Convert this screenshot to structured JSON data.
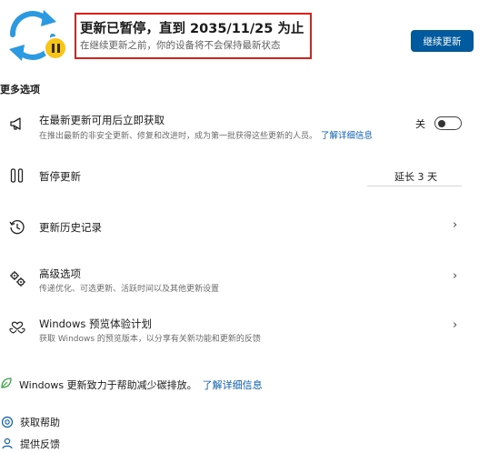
{
  "header": {
    "title": "更新已暂停，直到 2035/11/25 为止",
    "subtitle": "在继续更新之前，你的设备将不会保持最新状态",
    "resume_label": "继续更新"
  },
  "more_options": {
    "label": "更多选项",
    "items": [
      {
        "title": "在最新更新可用后立即获取",
        "desc": "在推出最新的非安全更新、修复和改进时，成为第一批获得这些更新的人员。",
        "link": "了解详细信息",
        "toggle_label": "关",
        "toggle_state": "off"
      },
      {
        "title": "暂停更新",
        "dropdown": "延长 3 天"
      },
      {
        "title": "更新历史记录"
      },
      {
        "title": "高级选项",
        "desc": "传递优化、可选更新、活跃时间以及其他更新设置"
      },
      {
        "title": "Windows 预览体验计划",
        "desc": "获取 Windows 的预览版本，以分享有关新功能和更新的反馈"
      }
    ]
  },
  "carbon": {
    "text": "Windows 更新致力于帮助减少碳排放。",
    "link": "了解详细信息"
  },
  "footer": {
    "get_help": "获取帮助",
    "feedback": "提供反馈"
  },
  "colors": {
    "accent": "#005a9e",
    "link": "#0a5fb4",
    "highlight_border": "#e0201b",
    "pause_badge": "#f5c518",
    "sync_icon": "#2b9ae0",
    "leaf_icon": "#3aa545"
  }
}
